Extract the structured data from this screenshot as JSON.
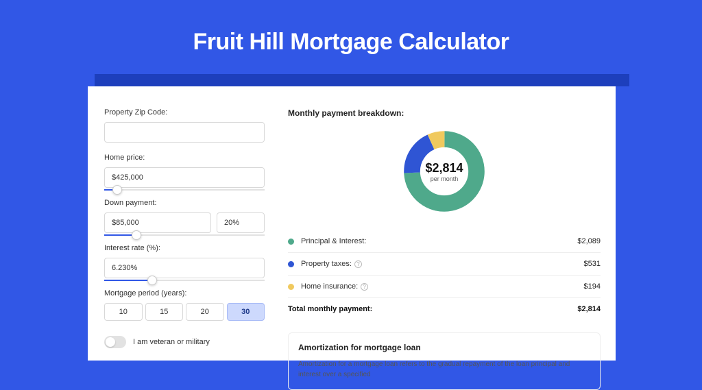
{
  "title": "Fruit Hill Mortgage Calculator",
  "form": {
    "zip_label": "Property Zip Code:",
    "zip_value": "",
    "price_label": "Home price:",
    "price_value": "$425,000",
    "price_slider_pct": 8,
    "down_label": "Down payment:",
    "down_value": "$85,000",
    "down_pct": "20%",
    "down_slider_pct": 20,
    "rate_label": "Interest rate (%):",
    "rate_value": "6.230%",
    "rate_slider_pct": 30,
    "period_label": "Mortgage period (years):",
    "period_options": [
      "10",
      "15",
      "20",
      "30"
    ],
    "period_active": "30",
    "veteran_label": "I am veteran or military"
  },
  "breakdown": {
    "title": "Monthly payment breakdown:",
    "total_display": "$2,814",
    "total_sub": "per month",
    "items": [
      {
        "label": "Principal & Interest:",
        "value": "$2,089",
        "color": "#4fa98b",
        "help": false
      },
      {
        "label": "Property taxes:",
        "value": "$531",
        "color": "#2f55d4",
        "help": true
      },
      {
        "label": "Home insurance:",
        "value": "$194",
        "color": "#f0c95e",
        "help": true
      }
    ],
    "total_label": "Total monthly payment:",
    "total_value": "$2,814"
  },
  "chart_data": {
    "type": "pie",
    "title": "Monthly payment breakdown",
    "series": [
      {
        "name": "Principal & Interest",
        "value": 2089,
        "color": "#4fa98b"
      },
      {
        "name": "Property taxes",
        "value": 531,
        "color": "#2f55d4"
      },
      {
        "name": "Home insurance",
        "value": 194,
        "color": "#f0c95e"
      }
    ],
    "total": 2814,
    "center_label": "$2,814",
    "center_sub": "per month"
  },
  "amort": {
    "title": "Amortization for mortgage loan",
    "text": "Amortization for a mortgage loan refers to the gradual repayment of the loan principal and interest over a specified"
  }
}
